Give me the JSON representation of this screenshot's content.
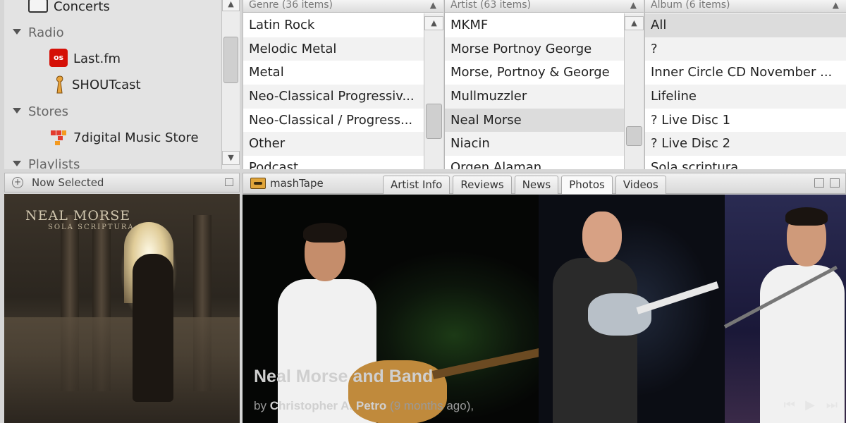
{
  "sources": {
    "concerts": "Concerts",
    "radio_group": "Radio",
    "lastfm": "Last.fm",
    "lastfm_logo_text": "os",
    "shoutcast": "SHOUTcast",
    "stores_group": "Stores",
    "digital7": "7digital Music Store",
    "playlists_group": "Playlists"
  },
  "genre": {
    "header": "Genre (36 items)",
    "items": [
      "Latin Rock",
      "Melodic Metal",
      "Metal",
      "Neo-Classical Progressiv...",
      "Neo-Classical / Progress...",
      "Other",
      "Podcast"
    ]
  },
  "artist": {
    "header": "Artist (63 items)",
    "items": [
      "MKMF",
      "Morse Portnoy George",
      "Morse, Portnoy & George",
      "Mullmuzzler",
      "Neal Morse",
      "Niacin",
      "Orgen Alaman"
    ],
    "selected": "Neal Morse"
  },
  "album": {
    "header": "Album (6 items)",
    "items": [
      "All",
      "?",
      "Inner Circle CD November ...",
      "Lifeline",
      "? Live Disc 1",
      "? Live Disc 2",
      "Sola scriptura"
    ],
    "selected": "All"
  },
  "now_selected": {
    "title": "Now Selected",
    "cover_artist": "NEAL MORSE",
    "cover_album": "SOLA SCRIPTURA"
  },
  "mashtape": {
    "title": "mashTape",
    "tabs": [
      "Artist Info",
      "Reviews",
      "News",
      "Photos",
      "Videos"
    ],
    "active_tab": "Photos",
    "photo_title": "Neal Morse and Band",
    "photo_by_prefix": "by",
    "photo_author": "Christopher A. Petro",
    "photo_age": "(9 months ago),"
  },
  "controls": {
    "prev": "⏮",
    "play": "▶",
    "next": "⏭"
  }
}
